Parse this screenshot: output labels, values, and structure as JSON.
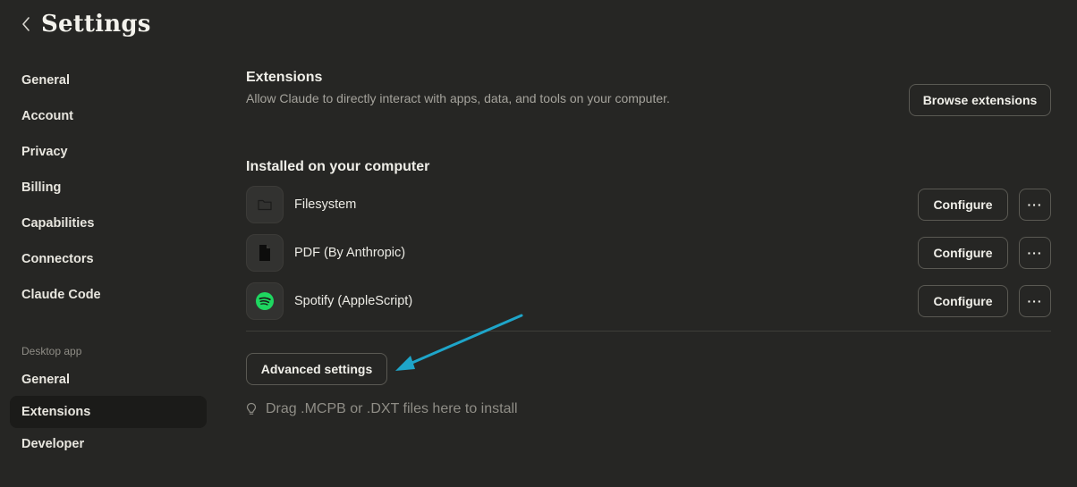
{
  "header": {
    "title": "Settings",
    "back_icon": "chevron-left-icon"
  },
  "sidebar": {
    "main_items": [
      {
        "label": "General"
      },
      {
        "label": "Account"
      },
      {
        "label": "Privacy"
      },
      {
        "label": "Billing"
      },
      {
        "label": "Capabilities"
      },
      {
        "label": "Connectors"
      },
      {
        "label": "Claude Code"
      }
    ],
    "desktop_section_label": "Desktop app",
    "desktop_items": [
      {
        "label": "General"
      },
      {
        "label": "Extensions",
        "active": true
      },
      {
        "label": "Developer"
      }
    ]
  },
  "extensions": {
    "title": "Extensions",
    "description": "Allow Claude to directly interact with apps, data, and tools on your computer.",
    "browse_label": "Browse extensions",
    "installed_title": "Installed on your computer",
    "items": [
      {
        "name": "Filesystem",
        "icon": "folder-icon",
        "configure_label": "Configure",
        "more_label": "···"
      },
      {
        "name": "PDF (By Anthropic)",
        "icon": "document-icon",
        "configure_label": "Configure",
        "more_label": "···"
      },
      {
        "name": "Spotify (AppleScript)",
        "icon": "spotify-icon",
        "configure_label": "Configure",
        "more_label": "···"
      }
    ],
    "advanced_label": "Advanced settings",
    "drop_hint": "Drag .MCPB or .DXT files here to install"
  },
  "colors": {
    "background": "#262624",
    "active_nav": "#1b1b19",
    "annotation_arrow": "#1ea5c9",
    "spotify_green": "#1ed760"
  }
}
